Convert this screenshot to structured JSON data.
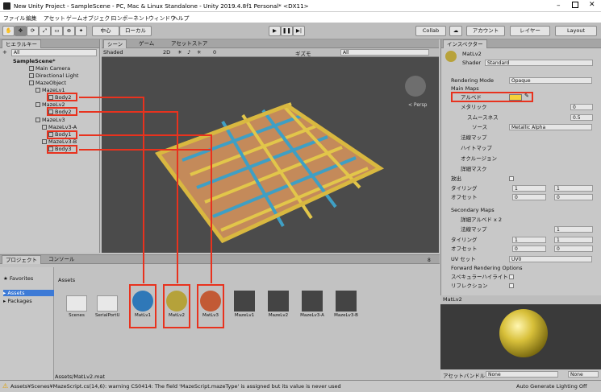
{
  "window": {
    "title": "New Unity Project - SampleScene - PC, Mac & Linux Standalone - Unity 2019.4.8f1 Personal* <DX11>"
  },
  "menu": [
    "ファイル",
    "編集",
    "アセット",
    "ゲームオブジェクト",
    "コンポーネント",
    "ウィンドウ",
    "ヘルプ"
  ],
  "toolbar": {
    "pivot": "中心",
    "space": "ローカル",
    "collab": "Collab",
    "account": "アカウント",
    "layers": "レイヤー",
    "layout": "Layout"
  },
  "hierarchy": {
    "tab": "ヒエラルキー",
    "create": "+",
    "search_placeholder": "All",
    "items": [
      {
        "label": "SampleScene*"
      },
      {
        "label": "Main Camera"
      },
      {
        "label": "Directional Light"
      },
      {
        "label": "MazeObject"
      },
      {
        "label": "MazeLv1"
      },
      {
        "label": "Body2"
      },
      {
        "label": "MazeLv2"
      },
      {
        "label": "Body2"
      },
      {
        "label": "MazeLv3"
      },
      {
        "label": "MazeLv3-A"
      },
      {
        "label": "Body1"
      },
      {
        "label": "MazeLv3-B"
      },
      {
        "label": "Body3"
      }
    ]
  },
  "scene": {
    "tab_scene": "シーン",
    "tab_game": "ゲーム",
    "tab_store": "アセットストア",
    "shading": "Shaded",
    "mode2d": "2D",
    "gizmos": "ギズモ",
    "search": "All",
    "persp": "< Persp",
    "counter": "0"
  },
  "inspector": {
    "tab": "インスペクター",
    "name": "MatLv2",
    "shader_label": "Shader",
    "shader_value": "Standard",
    "rendering_mode_label": "Rendering Mode",
    "rendering_mode_value": "Opaque",
    "main_maps": "Main Maps",
    "albedo": "アルベド",
    "metallic": "メタリック",
    "metallic_value": "0",
    "smoothness": "スムースネス",
    "smoothness_value": "0.5",
    "source": "ソース",
    "source_value": "Metallic Alpha",
    "normal": "法線マップ",
    "height": "ハイトマップ",
    "occlusion": "オクルージョン",
    "detail_mask": "詳細マスク",
    "emission": "放出",
    "tiling": "タイリング",
    "offset": "オフセット",
    "tiling_x": "1",
    "tiling_y": "1",
    "offset_x": "0",
    "offset_y": "0",
    "secondary": "Secondary Maps",
    "detail_albedo": "詳細アルベド x 2",
    "detail_normal": "法線マップ",
    "detail_normal_value": "1",
    "s_tiling_x": "1",
    "s_tiling_y": "1",
    "s_offset_x": "0",
    "s_offset_y": "0",
    "uv_label": "UV セット",
    "uv_value": "UV0",
    "forward": "Forward Rendering Options",
    "specular": "スペキュラーハイライト",
    "reflection": "リフレクション",
    "albedo_color": "#f5d23a"
  },
  "preview": {
    "title": "MatLv2",
    "assetbundle_label": "アセットバンドル",
    "bundle_none": "None",
    "variant_none": "None"
  },
  "project": {
    "tab_project": "プロジェクト",
    "tab_console": "コンソール",
    "breadcrumb": "Assets",
    "favorites": "Favorites",
    "tree": [
      "Assets",
      "Packages"
    ],
    "count": "8",
    "assets": [
      {
        "label": "Scenes",
        "kind": "folder"
      },
      {
        "label": "SerialPortUti...",
        "kind": "folder"
      },
      {
        "label": "MatLv1",
        "kind": "material",
        "color": "#2f78b8"
      },
      {
        "label": "MatLv2",
        "kind": "material",
        "color": "#b5a23a"
      },
      {
        "label": "MatLv3",
        "kind": "material",
        "color": "#c25a35"
      },
      {
        "label": "MazeLv1",
        "kind": "mesh"
      },
      {
        "label": "MazeLv2",
        "kind": "mesh"
      },
      {
        "label": "MazeLv3-A",
        "kind": "mesh"
      },
      {
        "label": "MazeLv3-B",
        "kind": "mesh"
      }
    ],
    "path": "Assets/MatLv2.mat"
  },
  "status": {
    "warning": "Assets¥Scenes¥MazeScript.cs(14,6): warning CS0414: The field 'MazeScript.mazeType' is assigned but its value is never used",
    "right": "Auto Generate Lighting Off"
  }
}
